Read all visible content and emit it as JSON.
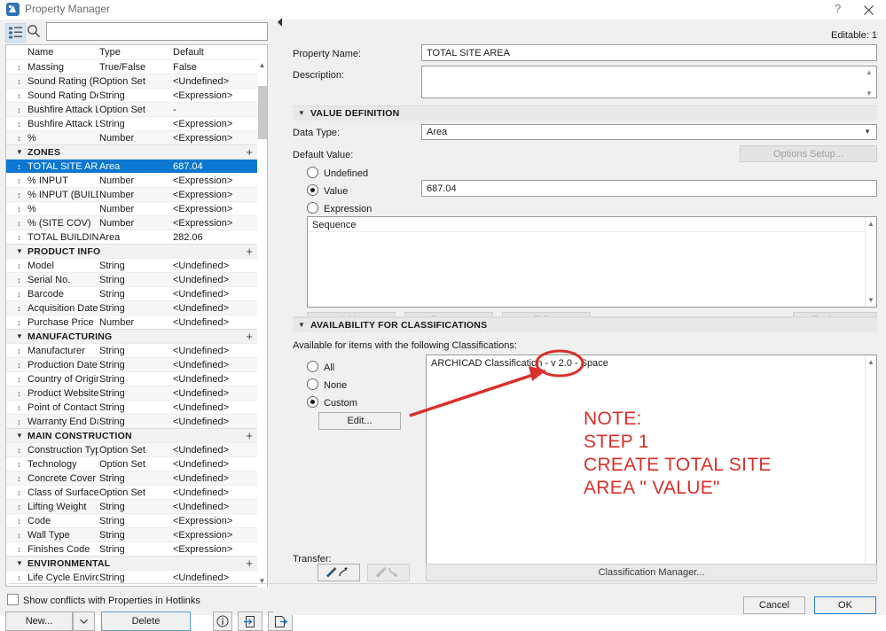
{
  "window": {
    "title": "Property Manager",
    "help_icon": "question-mark-icon",
    "close_icon": "close-icon"
  },
  "left_panel": {
    "search": {
      "value": "",
      "placeholder": ""
    },
    "columns": {
      "name": "Name",
      "type": "Type",
      "default": "Default"
    },
    "rows": [
      {
        "kind": "item",
        "name": "Massing",
        "type": "True/False",
        "default": "False"
      },
      {
        "kind": "item",
        "name": "Sound Rating (R...",
        "type": "Option Set",
        "default": "<Undefined>"
      },
      {
        "kind": "item",
        "name": "Sound Rating De...",
        "type": "String",
        "default": "<Expression>"
      },
      {
        "kind": "item",
        "name": "Bushfire Attack L...",
        "type": "Option Set",
        "default": "-"
      },
      {
        "kind": "item",
        "name": "Bushfire Attack L...",
        "type": "String",
        "default": "<Expression>"
      },
      {
        "kind": "item",
        "name": "%",
        "type": "Number",
        "default": "<Expression>"
      },
      {
        "kind": "group",
        "name": "ZONES",
        "type": "",
        "default": ""
      },
      {
        "kind": "selected",
        "name": "TOTAL SITE AREA",
        "type": "Area",
        "default": "687.04"
      },
      {
        "kind": "item",
        "name": "% INPUT",
        "type": "Number",
        "default": "<Expression>"
      },
      {
        "kind": "item",
        "name": "% INPUT (BUILD)",
        "type": "Number",
        "default": "<Expression>"
      },
      {
        "kind": "item",
        "name": "%",
        "type": "Number",
        "default": "<Expression>"
      },
      {
        "kind": "item",
        "name": "% (SITE COV)",
        "type": "Number",
        "default": "<Expression>"
      },
      {
        "kind": "item",
        "name": "TOTAL BUILDING ...",
        "type": "Area",
        "default": "282.06"
      },
      {
        "kind": "group",
        "name": "PRODUCT INFO",
        "type": "",
        "default": ""
      },
      {
        "kind": "item",
        "name": "Model",
        "type": "String",
        "default": "<Undefined>"
      },
      {
        "kind": "item",
        "name": "Serial No.",
        "type": "String",
        "default": "<Undefined>"
      },
      {
        "kind": "item",
        "name": "Barcode",
        "type": "String",
        "default": "<Undefined>"
      },
      {
        "kind": "item",
        "name": "Acquisition Date",
        "type": "String",
        "default": "<Undefined>"
      },
      {
        "kind": "item",
        "name": "Purchase Price",
        "type": "Number",
        "default": "<Undefined>"
      },
      {
        "kind": "group",
        "name": "MANUFACTURING",
        "type": "",
        "default": ""
      },
      {
        "kind": "item",
        "name": "Manufacturer",
        "type": "String",
        "default": "<Undefined>"
      },
      {
        "kind": "item",
        "name": "Production Date",
        "type": "String",
        "default": "<Undefined>"
      },
      {
        "kind": "item",
        "name": "Country of Origin",
        "type": "String",
        "default": "<Undefined>"
      },
      {
        "kind": "item",
        "name": "Product Website",
        "type": "String",
        "default": "<Undefined>"
      },
      {
        "kind": "item",
        "name": "Point of Contact",
        "type": "String",
        "default": "<Undefined>"
      },
      {
        "kind": "item",
        "name": "Warranty End Date",
        "type": "String",
        "default": "<Undefined>"
      },
      {
        "kind": "group",
        "name": "MAIN CONSTRUCTION",
        "type": "",
        "default": ""
      },
      {
        "kind": "item",
        "name": "Construction Type",
        "type": "Option Set",
        "default": "<Undefined>"
      },
      {
        "kind": "item",
        "name": "Technology",
        "type": "Option Set",
        "default": "<Undefined>"
      },
      {
        "kind": "item",
        "name": "Concrete Cover a...",
        "type": "String",
        "default": "<Undefined>"
      },
      {
        "kind": "item",
        "name": "Class of Surface",
        "type": "Option Set",
        "default": "<Undefined>"
      },
      {
        "kind": "item",
        "name": "Lifting Weight",
        "type": "String",
        "default": "<Undefined>"
      },
      {
        "kind": "item",
        "name": "Code",
        "type": "String",
        "default": "<Expression>"
      },
      {
        "kind": "item",
        "name": "Wall Type",
        "type": "String",
        "default": "<Expression>"
      },
      {
        "kind": "item",
        "name": "Finishes Code",
        "type": "String",
        "default": "<Expression>"
      },
      {
        "kind": "group",
        "name": "ENVIRONMENTAL",
        "type": "",
        "default": ""
      },
      {
        "kind": "item",
        "name": "Life Cycle Environ...",
        "type": "String",
        "default": "<Undefined>"
      }
    ],
    "group_add_label": "+",
    "hotlinks_checkbox": {
      "label": "Show conflicts with Properties in Hotlinks",
      "checked": false
    },
    "buttons": {
      "new": "New...",
      "new_dropdown_icon": "chevron-down-icon",
      "delete": "Delete",
      "info_icon": "info-icon",
      "import_icon": "import-icon",
      "export_icon": "export-icon"
    }
  },
  "right_panel": {
    "editable_status": "Editable: 1",
    "property_name": {
      "label": "Property Name:",
      "value": "TOTAL SITE AREA"
    },
    "description": {
      "label": "Description:",
      "value": ""
    },
    "value_definition": {
      "section_title": "VALUE DEFINITION",
      "data_type": {
        "label": "Data Type:",
        "value": "Area",
        "options": [
          "Area"
        ]
      },
      "default_value_label": "Default Value:",
      "options_setup_button": "Options Setup...",
      "radios": [
        {
          "label": "Undefined",
          "selected": false
        },
        {
          "label": "Value",
          "selected": true
        },
        {
          "label": "Expression",
          "selected": false
        }
      ],
      "value_field": "687.04",
      "expression_list_header": "Sequence",
      "expression_buttons": {
        "add": "Add...",
        "remove": "Remove",
        "edit": "Edit...",
        "evaluate": "Evaluate..."
      }
    },
    "availability": {
      "section_title": "AVAILABILITY FOR CLASSIFICATIONS",
      "intro": "Available for items with the following Classifications:",
      "radios": [
        {
          "label": "All",
          "selected": false
        },
        {
          "label": "None",
          "selected": false
        },
        {
          "label": "Custom",
          "selected": true
        }
      ],
      "edit_button": "Edit...",
      "classification_items": [
        "ARCHICAD Classification - v 2.0 - Space"
      ]
    },
    "transfer": {
      "label": "Transfer:",
      "pick_icon": "eyedropper-icon",
      "inject_icon": "syringe-icon"
    },
    "classification_manager_button": "Classification Manager...",
    "cancel_button": "Cancel",
    "ok_button": "OK"
  },
  "annotation": {
    "note_text": "NOTE:\nSTEP 1\nCREATE TOTAL SITE\nAREA \" VALUE\"",
    "color": "#d9312b",
    "circle_target": "Space",
    "arrow": "red-arrow"
  },
  "colors": {
    "selection_blue": "#0a78d1",
    "accent_border": "#2f7fd1",
    "annotation_red": "#d9312b",
    "panel_bg": "#f0f0f0"
  }
}
